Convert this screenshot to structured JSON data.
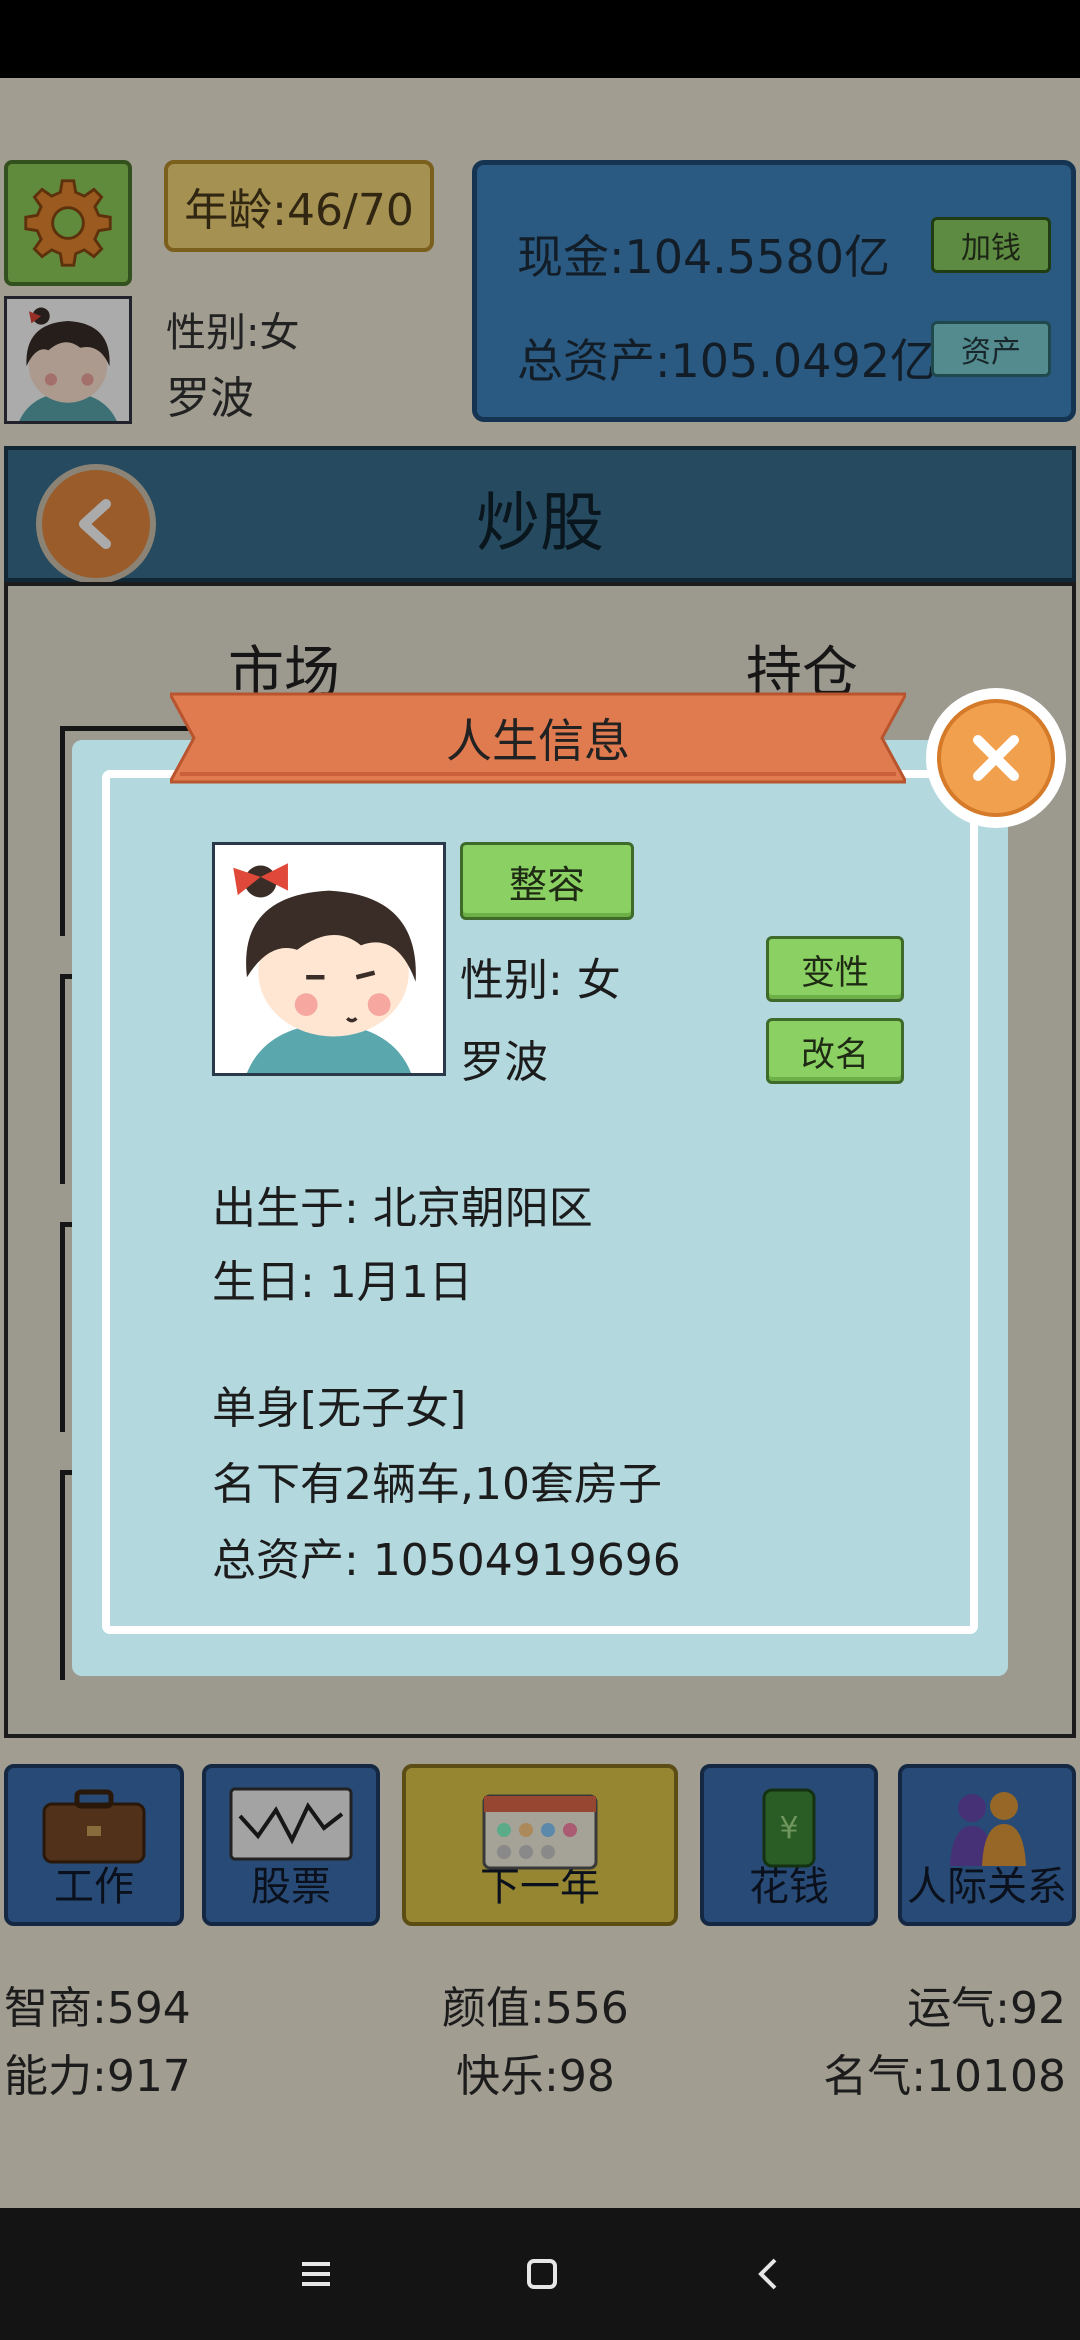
{
  "hud": {
    "age": "年龄:46/70",
    "gender": "性别:女",
    "name": "罗波",
    "cash_label": "现金:",
    "cash_value": "104.5580亿",
    "add_money_btn": "加钱",
    "assets_label": "总资产:",
    "assets_value": "105.0492亿",
    "assets_btn": "资产"
  },
  "stock_screen": {
    "title": "炒股",
    "tab_market": "市场",
    "tab_holdings": "持仓"
  },
  "actions": [
    {
      "label": "工作",
      "icon": "briefcase-icon"
    },
    {
      "label": "股票",
      "icon": "stock-chart-icon"
    },
    {
      "label": "下一年",
      "icon": "calendar-icon"
    },
    {
      "label": "花钱",
      "icon": "money-bag-icon"
    },
    {
      "label": "人际关系",
      "icon": "people-icon"
    }
  ],
  "stats": {
    "iq": "智商:594",
    "looks": "颜值:556",
    "luck": "运气:92",
    "ability": "能力:917",
    "happiness": "快乐:98",
    "fame": "名气:10108"
  },
  "modal": {
    "title": "人生信息",
    "plastic_surgery_btn": "整容",
    "gender": "性别: 女",
    "change_gender_btn": "变性",
    "name": "罗波",
    "rename_btn": "改名",
    "birthplace": "出生于: 北京朝阳区",
    "birthday": "生日: 1月1日",
    "marital": "单身[无子女]",
    "property": "名下有2辆车,10套房子",
    "total_assets": "总资产:  10504919696"
  },
  "colors": {
    "modal_bg": "#b3d9df",
    "ribbon": "#e07a4f",
    "button_green": "#8bd063",
    "close_orange": "#f1a04e"
  }
}
